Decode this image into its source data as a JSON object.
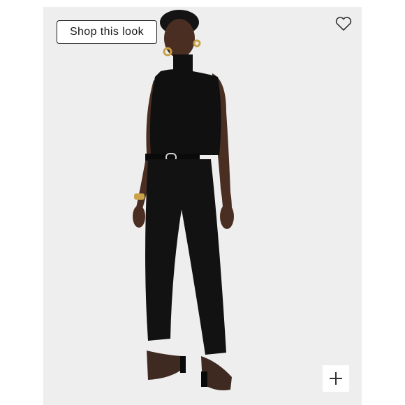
{
  "shop_look": {
    "label": "Shop this look"
  },
  "icons": {
    "favorite": "heart-outline-icon",
    "expand": "plus-icon"
  },
  "colors": {
    "background": "#eeeeee",
    "garment": "#101010",
    "skin": "#4a2e22",
    "accent_gold": "#c9a24a"
  }
}
